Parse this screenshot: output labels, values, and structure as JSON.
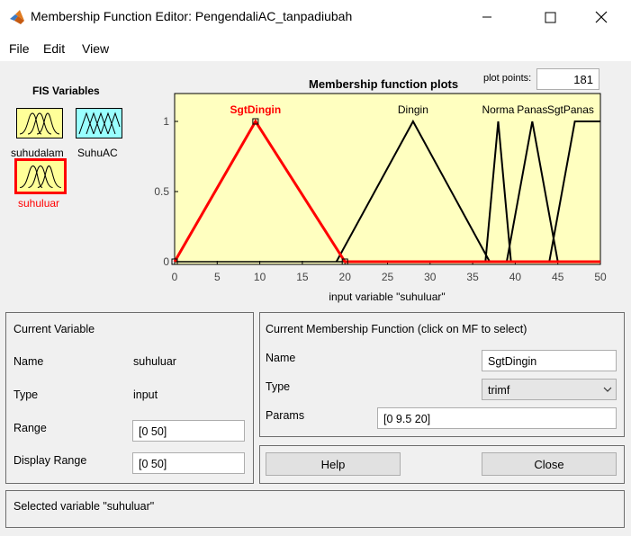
{
  "window": {
    "title": "Membership Function Editor: PengendaliAC_tanpadiubah",
    "minimize_icon": "minimize-icon",
    "maximize_icon": "maximize-icon",
    "close_icon": "close-icon"
  },
  "menu": {
    "items": [
      "File",
      "Edit",
      "View"
    ]
  },
  "fis_variables": {
    "title": "FIS Variables",
    "inputs": [
      "suhudalam",
      "suhuluar"
    ],
    "outputs": [
      "SuhuAC"
    ],
    "selected": "suhuluar",
    "input_color": "#ffff99",
    "output_color": "#99ffff",
    "selected_color": "#ff0000"
  },
  "plot": {
    "title": "Membership function plots",
    "plot_points_label": "plot points:",
    "plot_points": "181",
    "xlabel": "input variable \"suhuluar\"",
    "x_ticks": [
      "0",
      "5",
      "10",
      "15",
      "20",
      "25",
      "30",
      "35",
      "40",
      "45",
      "50"
    ],
    "y_ticks": [
      "0",
      "0.5",
      "1"
    ],
    "background": "#ffffc0",
    "selected_color": "#ff0000"
  },
  "chart_data": {
    "type": "line",
    "title": "Membership function plots",
    "xlabel": "input variable \"suhuluar\"",
    "xlim": [
      0,
      50
    ],
    "ylim": [
      0,
      1.2
    ],
    "series": [
      {
        "name": "SgtDingin",
        "type": "trimf",
        "points": [
          [
            0,
            0
          ],
          [
            9.5,
            1
          ],
          [
            20,
            0
          ]
        ],
        "selected": true
      },
      {
        "name": "Dingin",
        "type": "trimf",
        "points": [
          [
            19,
            0
          ],
          [
            28,
            1
          ],
          [
            37,
            0
          ]
        ],
        "selected": false
      },
      {
        "name": "Normal",
        "type": "trimf",
        "points": [
          [
            36.5,
            0
          ],
          [
            38,
            1
          ],
          [
            39.5,
            0
          ]
        ],
        "selected": false
      },
      {
        "name": "Panas",
        "type": "trimf",
        "points": [
          [
            39,
            0
          ],
          [
            42,
            1
          ],
          [
            45,
            0
          ]
        ],
        "selected": false
      },
      {
        "name": "SgtPanas",
        "type": "trapmf",
        "points": [
          [
            44,
            0
          ],
          [
            47,
            1
          ],
          [
            50,
            1
          ]
        ],
        "selected": false
      }
    ],
    "labels": [
      {
        "text": "SgtDingin",
        "x": 9.5,
        "selected": true
      },
      {
        "text": "Dingin",
        "x": 28,
        "selected": false
      },
      {
        "text": "Norma",
        "x": 38,
        "selected": false
      },
      {
        "text": "Panas",
        "x": 42,
        "selected": false
      },
      {
        "text": "SgtPanas",
        "x": 46.5,
        "selected": false
      }
    ]
  },
  "current_variable": {
    "title": "Current Variable",
    "name_label": "Name",
    "name_value": "suhuluar",
    "type_label": "Type",
    "type_value": "input",
    "range_label": "Range",
    "range_value": "[0 50]",
    "display_range_label": "Display Range",
    "display_range_value": "[0 50]"
  },
  "current_mf": {
    "title": "Current Membership Function (click on MF to select)",
    "name_label": "Name",
    "name_value": "SgtDingin",
    "type_label": "Type",
    "type_value": "trimf",
    "params_label": "Params",
    "params_value": "[0 9.5 20]"
  },
  "buttons": {
    "help": "Help",
    "close": "Close"
  },
  "status": "Selected variable \"suhuluar\""
}
